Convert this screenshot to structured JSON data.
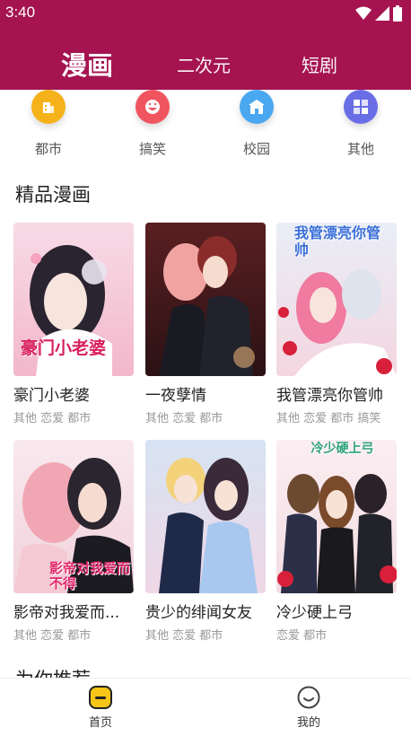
{
  "status_bar": {
    "time": "3:40"
  },
  "top_tabs": {
    "active": "漫画",
    "second": "二次元",
    "third": "短剧"
  },
  "categories": [
    {
      "label": "都市",
      "color": "#f5b21a",
      "icon": "building-icon"
    },
    {
      "label": "搞笑",
      "color": "#f0555f",
      "icon": "smile-icon"
    },
    {
      "label": "校园",
      "color": "#4aa8f0",
      "icon": "school-icon"
    },
    {
      "label": "其他",
      "color": "#6a6ee6",
      "icon": "grid-icon"
    }
  ],
  "section": {
    "title": "精品漫画",
    "next_title_partial": "为你推荐"
  },
  "comics": [
    {
      "title": "豪门小老婆",
      "tags": "其他 恋爱 都市",
      "cover_caption": "豪门小老婆"
    },
    {
      "title": "一夜孽情",
      "tags": "其他 恋爱 都市",
      "cover_caption": ""
    },
    {
      "title": "我管漂亮你管帅",
      "tags": "其他 恋爱 都市 搞笑",
      "cover_caption": "我管漂亮你管帅"
    },
    {
      "title": "影帝对我爱而...",
      "tags": "其他 恋爱 都市",
      "cover_caption": "影帝对我爱而不得"
    },
    {
      "title": "贵少的绯闻女友",
      "tags": "其他 恋爱 都市",
      "cover_caption": ""
    },
    {
      "title": "冷少硬上弓",
      "tags": "恋爱 都市",
      "cover_caption": "冷少硬上弓"
    }
  ],
  "bottom_nav": {
    "home": "首页",
    "mine": "我的"
  },
  "colors": {
    "brand": "#a51451",
    "home_icon": "#f5c518"
  }
}
